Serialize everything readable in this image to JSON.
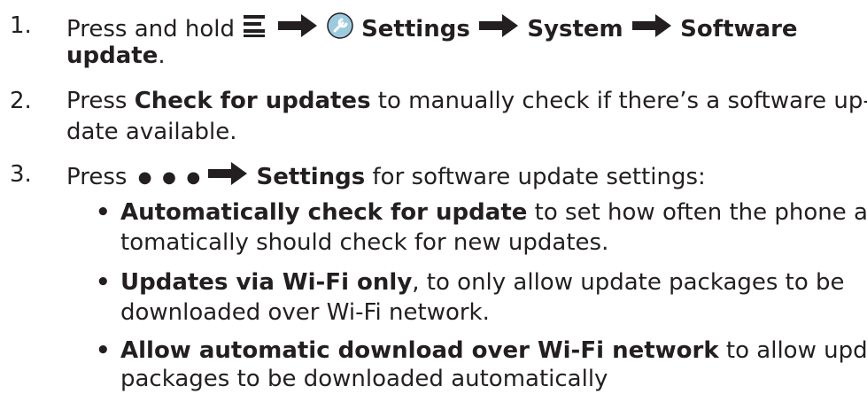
{
  "steps": [
    {
      "number": "1.",
      "prefix": "Press and hold",
      "settings_label": "Settings",
      "system_label": "System",
      "software_label": "Software",
      "line2_bold": "update",
      "line2_tail": "."
    },
    {
      "number": "2.",
      "pre": "Press ",
      "bold": "Check for updates",
      "tail_line1": " to manually check if there’s a software up-",
      "line2": "date available."
    },
    {
      "number": "3.",
      "pre": "Press",
      "dots": "● ● ●",
      "bold": "Settings",
      "tail": " for software update settings:"
    }
  ],
  "sub_items": [
    {
      "bullet": "•",
      "bold": "Automatically check for update",
      "tail_line1": " to set how often the phone au-",
      "line2": "tomatically should check for new updates."
    },
    {
      "bullet": "•",
      "bold": "Updates via Wi-Fi only",
      "tail_line1": ", to only allow update packages to be",
      "line2": "downloaded over Wi-Fi network."
    },
    {
      "bullet": "•",
      "bold": "Allow automatic download over Wi-Fi network",
      "tail_line1": " to allow update",
      "line2": "packages to be downloaded automatically"
    }
  ],
  "icons": [
    "menu-icon",
    "arrow-right-icon",
    "settings-wrench-icon"
  ]
}
